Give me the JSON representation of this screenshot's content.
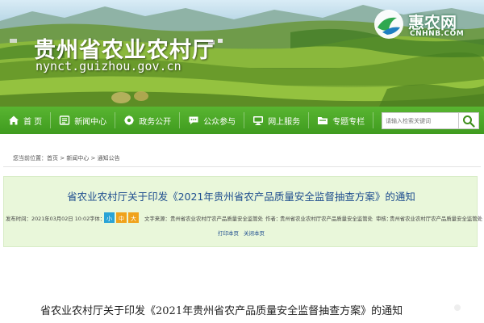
{
  "header": {
    "site_title": "贵州省农业农村厅",
    "site_domain": "nynct.guizhou.gov.cn",
    "watermark": {
      "title": "惠农网",
      "subtitle": "CNHNB.COM"
    }
  },
  "nav": {
    "items": [
      {
        "label": "首 页",
        "icon": "home-icon"
      },
      {
        "label": "新闻中心",
        "icon": "news-icon"
      },
      {
        "label": "政务公开",
        "icon": "gear-icon"
      },
      {
        "label": "公众参与",
        "icon": "chat-icon"
      },
      {
        "label": "网上服务",
        "icon": "monitor-icon"
      },
      {
        "label": "专题专栏",
        "icon": "folder-icon"
      }
    ],
    "search_placeholder": "请输入检索关键词"
  },
  "breadcrumb": {
    "prefix": "您当前位置：",
    "items": [
      "首页",
      "新闻中心",
      "通知公告"
    ],
    "separator": " > "
  },
  "article": {
    "title": "省农业农村厅关于印发《2021年贵州省农产品质量安全监督抽查方案》的通知",
    "meta": {
      "date_label": "发布时间：",
      "date": "2021年03月02日 10:02",
      "font_label": "字体：",
      "font_sizes": [
        "小",
        "中",
        "大"
      ],
      "source_label": "文字来源：",
      "source": "贵州省农业农村厅农产品质量安全监管处",
      "author_label": "作者：",
      "author": "贵州省农业农村厅农产品质量安全监管处",
      "reviewer_label": "审核：",
      "reviewer": "贵州省农业农村厅农产品质量安全监管处"
    },
    "print_label": "打印本页",
    "close_label": "关闭本页"
  },
  "body": {
    "heading": "省农业农村厅关于印发《2021年贵州省农产品质量安全监督抽查方案》的通知"
  },
  "colors": {
    "nav_green": "#3f9b1f",
    "title_blue": "#1f4e8f",
    "article_bg": "#e9f7da",
    "font_small": "#29a3d6",
    "font_medium": "#f0a21b",
    "font_large": "#f0a21b"
  }
}
